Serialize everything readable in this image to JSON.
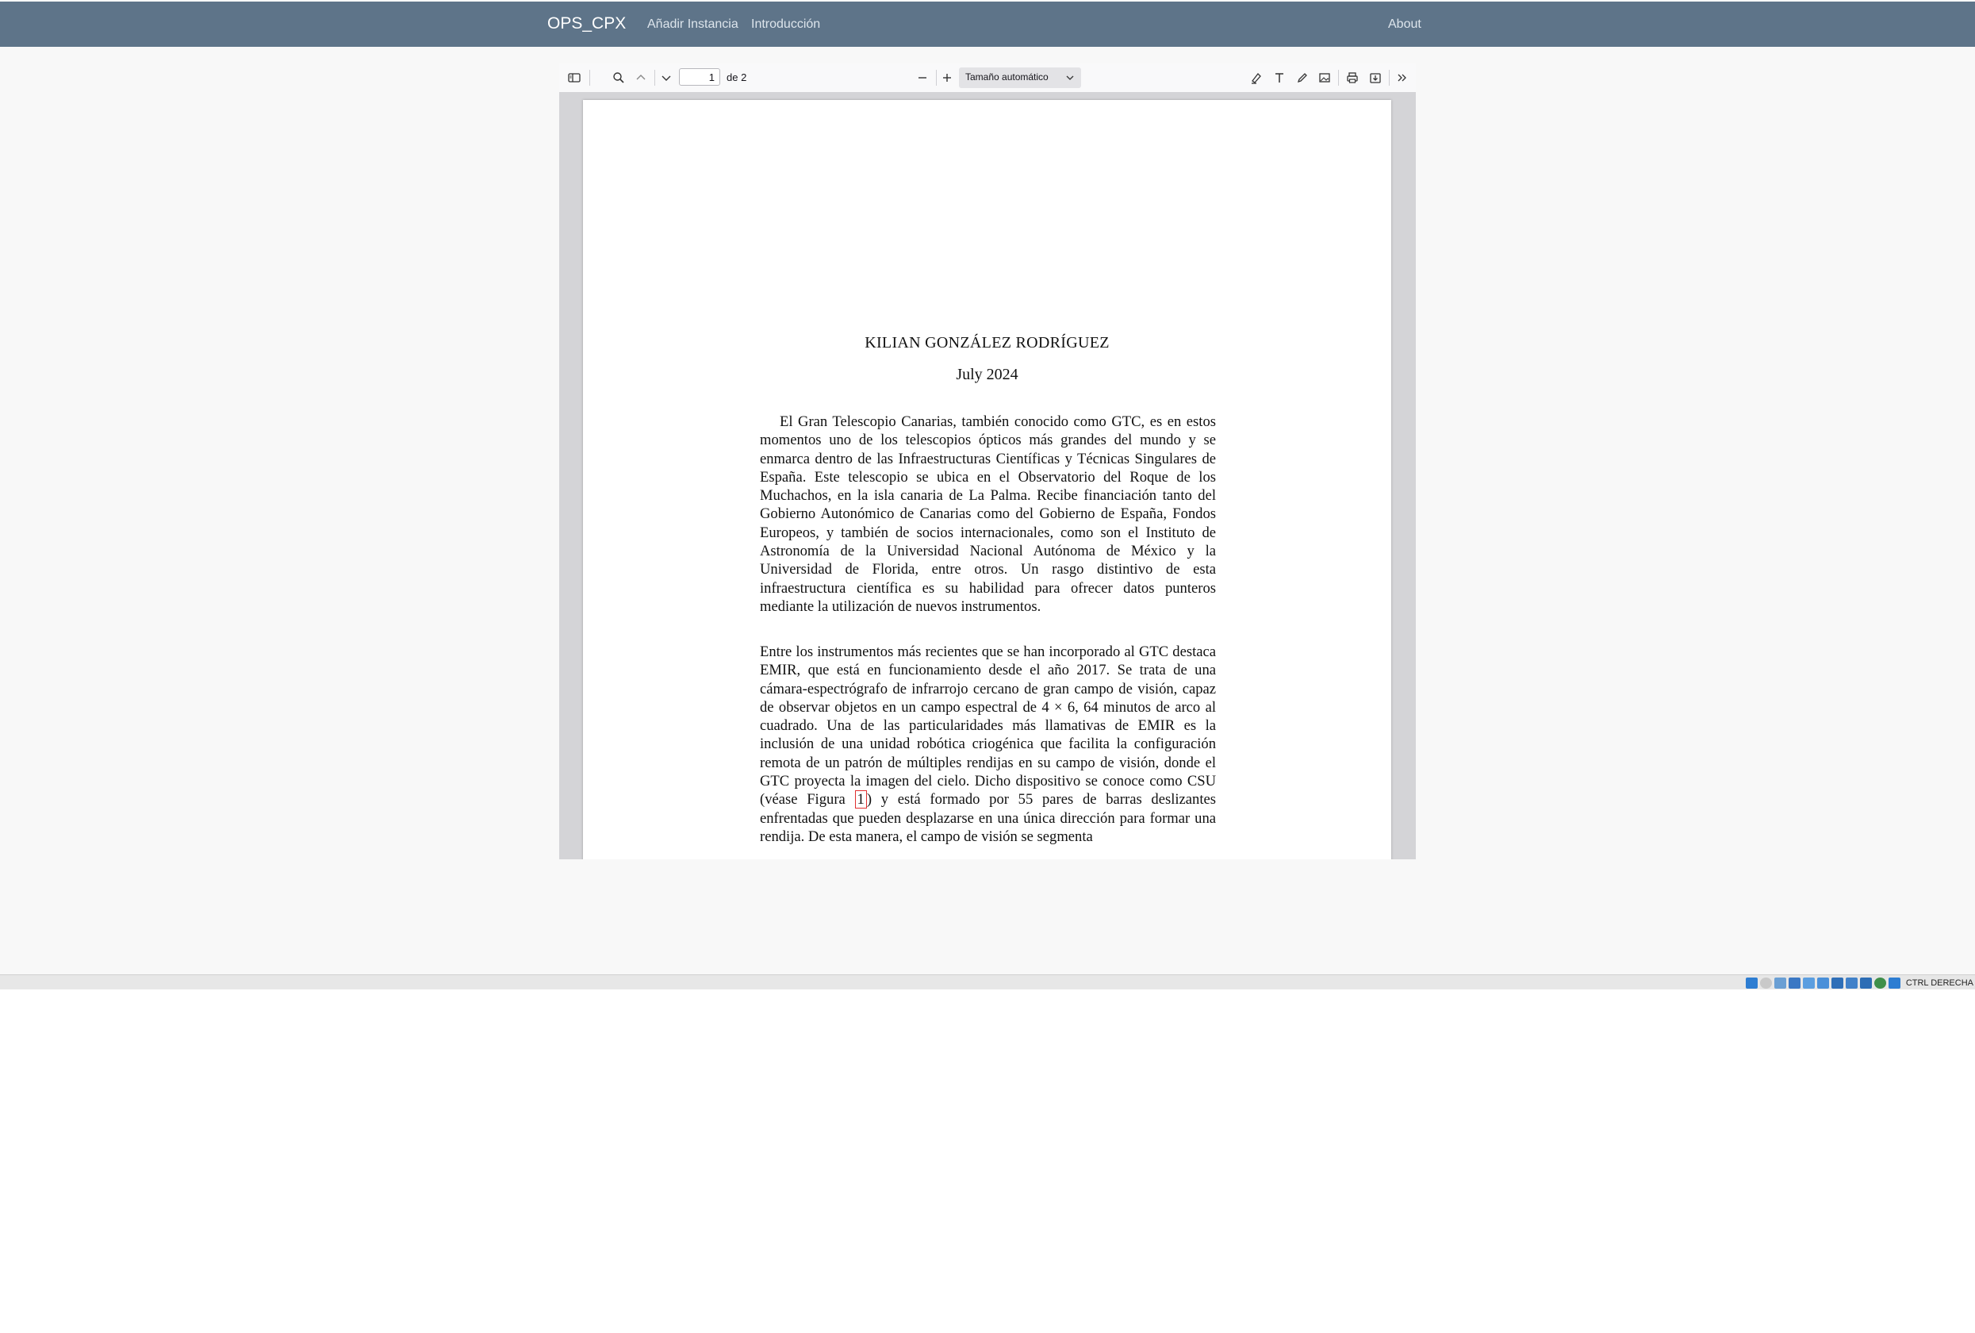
{
  "navbar": {
    "brand": "OPS_CPX",
    "links": [
      "Añadir Instancia",
      "Introducción"
    ],
    "about": "About"
  },
  "pdf_toolbar": {
    "current_page": "1",
    "page_count": "de 2",
    "zoom": "Tamaño automático"
  },
  "document": {
    "author": "KILIAN GONZÁLEZ RODRÍGUEZ",
    "date": "July 2024",
    "paragraph_1": "El Gran Telescopio Canarias, también conocido como GTC, es en estos momentos uno de los telescopios ópticos más grandes del mundo y se enmarca dentro de las Infraestructuras Científicas y Técnicas Singulares de España. Este telescopio se ubica en el Observatorio del Roque de los Muchachos, en la isla canaria de La Palma. Recibe financiación tanto del Gobierno Autonómico de Canarias como del Gobierno de España, Fondos Europeos, y también de socios internacionales, como son el Instituto de Astronomía de la Universidad Nacional Autónoma de México y la Universidad de Florida, entre otros. Un rasgo distintivo de esta infraestructura científica es su habilidad para ofrecer datos punteros mediante la utilización de nuevos instrumentos.",
    "paragraph_2_before": "Entre los instrumentos más recientes que se han incorporado al GTC destaca EMIR, que está en funcionamiento desde el año 2017. Se trata de una cámara-espectrógrafo de infrarrojo cercano de gran campo de visión, capaz de observar objetos en un campo espectral de 4 × 6, 64 minutos de arco al cuadrado. Una de las particularidades más llamativas de EMIR es la inclusión de una unidad robótica criogénica que facilita la configuración remota de un patrón de múltiples rendijas en su campo de visión, donde el GTC proyecta la imagen del cielo. Dicho dispositivo se conoce como CSU (véase Figura ",
    "figure_ref": "1",
    "paragraph_2_after": ") y está formado por 55 pares de barras deslizantes enfrentadas que pueden desplazarse en una única dirección para formar una rendija. De esta manera, el campo de visión se segmenta"
  },
  "status_bar": {
    "host_key": "CTRL DERECHA"
  }
}
